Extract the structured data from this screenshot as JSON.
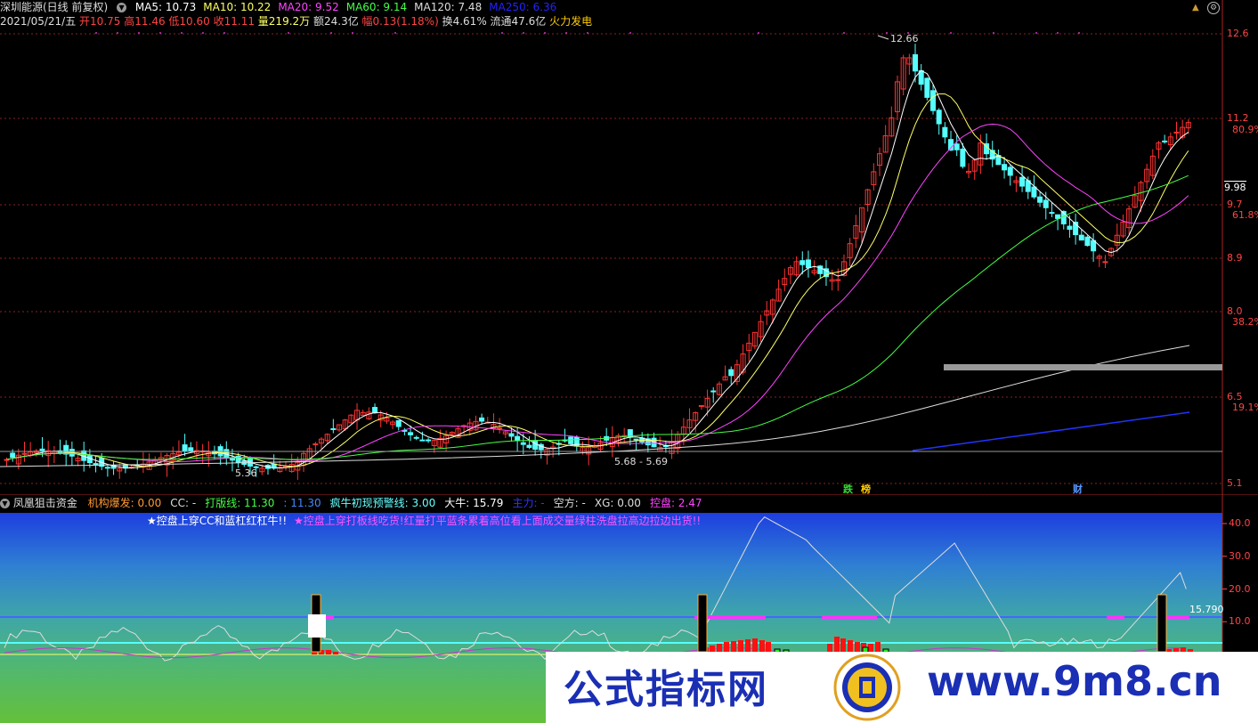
{
  "header": {
    "stock_name": "深圳能源(日线 前复权)",
    "ma_lines": [
      {
        "label": "MA5: 10.73",
        "color": "#ffffff"
      },
      {
        "label": "MA10: 10.22",
        "color": "#ffff66"
      },
      {
        "label": "MA20: 9.52",
        "color": "#ff44ff"
      },
      {
        "label": "MA60: 9.14",
        "color": "#44ff44"
      },
      {
        "label": "MA120: 7.48",
        "color": "#dddddd"
      },
      {
        "label": "MA250: 6.36",
        "color": "#2222ff"
      }
    ],
    "date": "2021/05/21/五",
    "open": "开10.75",
    "high": "高11.46",
    "low": "低10.60",
    "close": "收11.11",
    "volume": "量219.2万",
    "amount": "额24.3亿",
    "change": "幅0.13(1.18%)",
    "turnover": "换4.61%",
    "float": "流通47.6亿",
    "sector": "火力发电",
    "up_icon": "triangle-up-icon",
    "settings_icon": "gear-icon"
  },
  "main_chart": {
    "price_axis": [
      "12.6",
      "11.2",
      "9.7",
      "8.9",
      "8.0",
      "6.5",
      "5.1"
    ],
    "pct_axis": [
      "80.9%",
      "61.8%",
      "38.2%",
      "19.1%"
    ],
    "current_price_tag": "9.98",
    "annotations": {
      "high_label": "12.66",
      "low_label": "5.36",
      "range_label": "5.68 - 5.69"
    },
    "event_tags": [
      {
        "text": "跌",
        "color": "#33dd33"
      },
      {
        "text": "榜",
        "color": "#ffcc00"
      },
      {
        "text": "财",
        "color": "#5599ff"
      }
    ]
  },
  "sub_chart": {
    "indicator_name": "凤凰狙击资金",
    "values": [
      {
        "label": "机构爆发: 0.00",
        "color": "#ff9933"
      },
      {
        "label": "CC: -",
        "color": "#dddddd"
      },
      {
        "label": "打版线: 11.30",
        "color": "#44ff44"
      },
      {
        "label": ": 11.30",
        "color": "#4488ff"
      },
      {
        "label": "疯牛初现预警线: 3.00",
        "color": "#66ffff"
      },
      {
        "label": "大牛: 15.79",
        "color": "#ffffff"
      },
      {
        "label": "主力: -",
        "color": "#3333ff"
      },
      {
        "label": "空方: -",
        "color": "#dddddd"
      },
      {
        "label": "XG: 0.00",
        "color": "#dddddd"
      },
      {
        "label": "控盘: 2.47",
        "color": "#ff44ff"
      }
    ],
    "tip_white": "★控盘上穿CC和蓝杠红杠牛!!",
    "tip_blue": "★控盘上穿打板线吃货!红量打平蓝条累着高位看上面成交量绿柱洗盘拉高边拉边出货!!",
    "axis": [
      "40.0",
      "30.0",
      "20.0",
      "10.0"
    ],
    "current_label": "15.790"
  },
  "watermark": {
    "left_text": "公式指标网",
    "right_text": "www.9m8.cn"
  }
}
